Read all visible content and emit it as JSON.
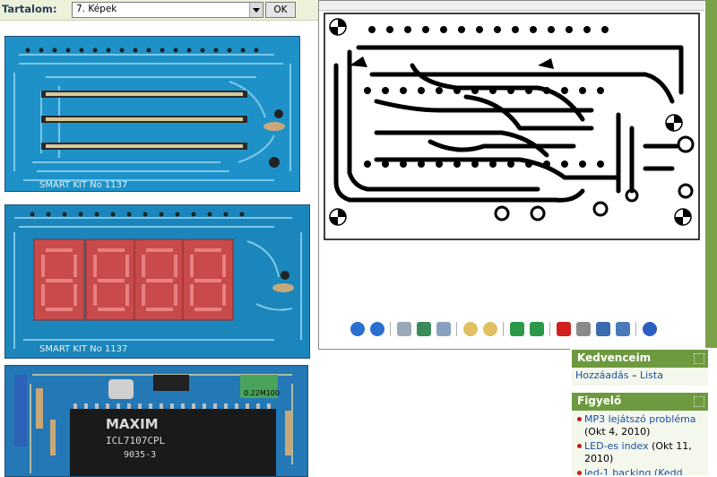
{
  "topbar": {
    "label": "Tartalom:",
    "select_value": "7. Képek",
    "ok_label": "OK"
  },
  "photos": [
    {
      "silkscreen": "SMART KIT No 1137"
    },
    {
      "silkscreen": "SMART KIT No 1137"
    },
    {
      "chip_brand": "MAXIM",
      "chip_part": "ICL7107CPL",
      "chip_code": "9035-3",
      "component_label": "0.22M100"
    }
  ],
  "viewer": {
    "toolbar_icons": [
      "first-page-icon",
      "next-page-icon",
      "fit-icon",
      "move-icon",
      "select-icon",
      "zoom-in-icon",
      "zoom-out-icon",
      "rotate-left-icon",
      "rotate-right-icon",
      "delete-icon",
      "print-icon",
      "save-icon",
      "edit-icon",
      "help-icon"
    ]
  },
  "favorites": {
    "title": "Kedvenceim",
    "add_label": "Hozzáadás",
    "separator": "–",
    "list_label": "Lista"
  },
  "watch": {
    "title": "Figyelő",
    "items": [
      {
        "title": "MP3 lejátszó probléma",
        "date": "(Okt 4, 2010)"
      },
      {
        "title": "LED-es index",
        "date": "(Okt 11, 2010)"
      },
      {
        "title": "led-1 backing (Kedd",
        "date": ""
      }
    ]
  },
  "colors": {
    "header_green": "#6e9a3f",
    "pcb_blue": "#1d8fc4",
    "link_blue": "#1a4fa0",
    "bullet_red": "#c81a1a"
  }
}
